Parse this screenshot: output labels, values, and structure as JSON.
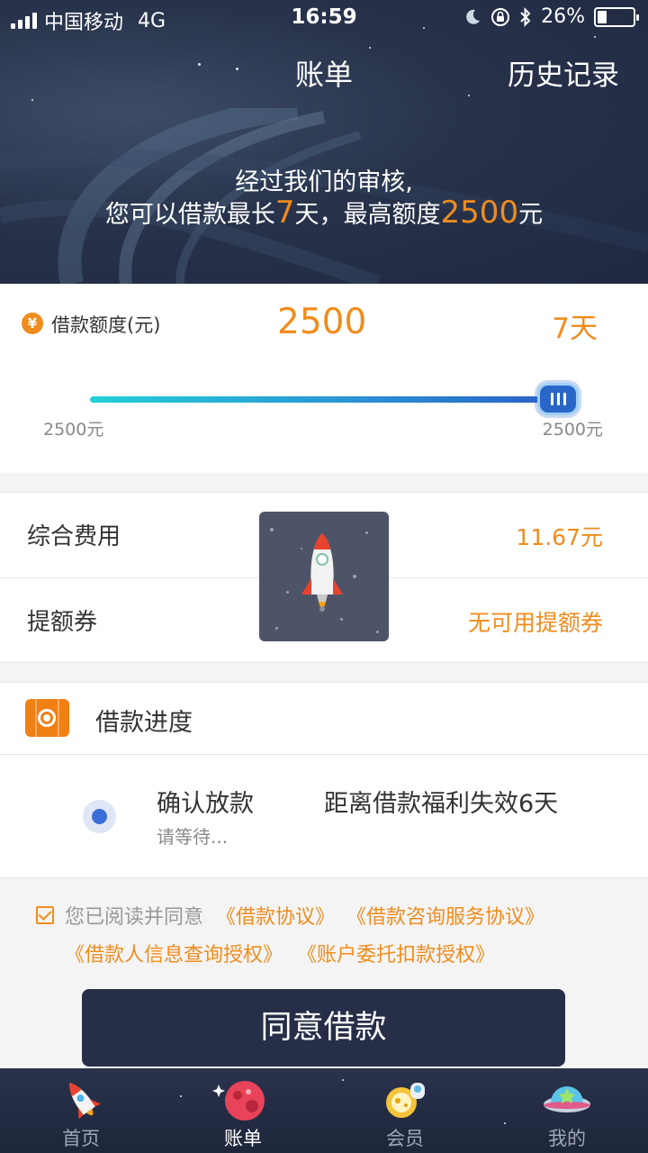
{
  "status_bar": {
    "carrier": "中国移动",
    "network": "4G",
    "time": "16:59",
    "battery_percent": "26%",
    "battery_level": 0.26
  },
  "nav": {
    "title": "账单",
    "history": "历史记录"
  },
  "banner": {
    "line1": "经过我们的审核,",
    "line2_a": "您可以借款最长",
    "line2_days": "7",
    "line2_b": "天，最高额度",
    "line2_amount": "2500",
    "line2_c": "元"
  },
  "amount_card": {
    "currency_icon": "¥",
    "label": "借款额度(元)",
    "amount": "2500",
    "days": "7天",
    "slider_min": "2500元",
    "slider_max": "2500元",
    "slider_position": 1.0
  },
  "fees": {
    "total_fee_label": "综合费用",
    "total_fee_value": "11.67元",
    "coupon_label": "提额券",
    "coupon_value": "无可用提额券"
  },
  "progress": {
    "title": "借款进度",
    "step_title": "确认放款",
    "step_sub": "请等待...",
    "note": "距离借款福利失效6天"
  },
  "agreement": {
    "checked": true,
    "prefix": "您已阅读并同意",
    "link1": "《借款协议》",
    "link2": "《借款咨询服务协议》",
    "link3": "《借款人信息查询授权》",
    "link4": "《账户委托扣款授权》"
  },
  "submit": {
    "label": "同意借款"
  },
  "tabs": [
    {
      "label": "首页",
      "icon": "rocket-icon"
    },
    {
      "label": "账单",
      "icon": "planet-icon"
    },
    {
      "label": "会员",
      "icon": "astronaut-icon"
    },
    {
      "label": "我的",
      "icon": "ufo-icon"
    }
  ],
  "active_tab": 1,
  "colors": {
    "accent": "#f08c1d",
    "header_bg": "#28334b",
    "button_bg": "#262f47",
    "slider_start": "#23cfd6",
    "slider_end": "#2a5fc4"
  }
}
